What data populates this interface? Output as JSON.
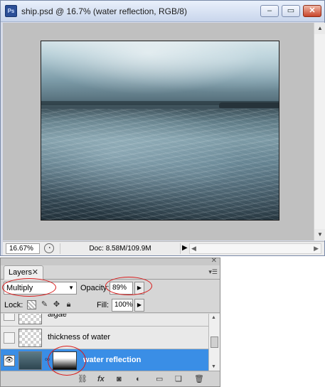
{
  "document_window": {
    "app_icon_text": "Ps",
    "title": "ship.psd @ 16.7% (water reflection, RGB/8)",
    "buttons": {
      "minimize": "–",
      "maximize": "▭",
      "close": "✕"
    }
  },
  "status_bar": {
    "zoom": "16.67%",
    "doc_size": "Doc: 8.58M/109.9M",
    "menu_arrow": "▶"
  },
  "layers_panel": {
    "tab_label": "Layers",
    "tab_close": "✕",
    "panel_close": "✕",
    "panel_menu": "▾☰",
    "blend_mode": "Multiply",
    "opacity_label": "Opacity:",
    "opacity_value": "89%",
    "lock_label": "Lock:",
    "fill_label": "Fill:",
    "fill_value": "100%",
    "layers": [
      {
        "name": "algae",
        "visible": false,
        "selected": false
      },
      {
        "name": "thickness of water",
        "visible": false,
        "selected": false
      },
      {
        "name": "water reflection",
        "visible": true,
        "selected": true,
        "has_mask": true
      }
    ],
    "bottom_icons": [
      "link-icon",
      "fx-icon",
      "mask-icon",
      "adjustment-icon",
      "group-folder-icon",
      "new-layer-icon",
      "trash-icon"
    ]
  },
  "colors": {
    "selection_blue": "#3a8ee6",
    "annotation_red": "#d91a1a",
    "canvas_grey": "#c0c0c0"
  }
}
